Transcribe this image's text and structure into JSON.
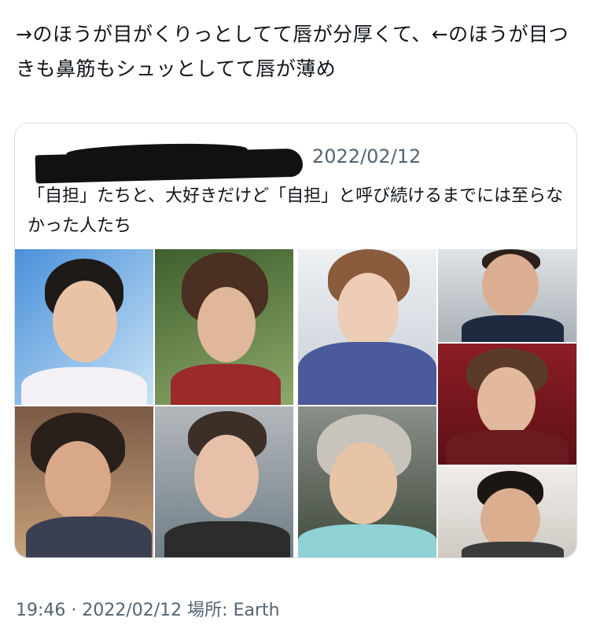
{
  "tweet": {
    "text": "→のほうが目がくりっとしてて唇が分厚くて、←のほうが目つきも鼻筋もシュッとしてて唇が薄め"
  },
  "quote": {
    "date": "2022/02/12",
    "text": "「自担」たちと、大好きだけど「自担」と呼び続けるまでには至らなかった人たち"
  },
  "footer": {
    "meta": "19:46 · 2022/02/12 場所: Earth"
  },
  "colors": {
    "text": "#0f1419",
    "secondary": "#536471",
    "border": "#d6dde3"
  }
}
